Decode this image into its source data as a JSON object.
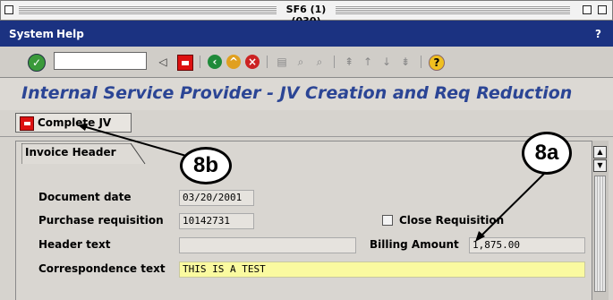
{
  "window": {
    "title": "SF6 (1) (030)"
  },
  "menu": {
    "items": [
      "System",
      "Help"
    ],
    "help_mark": "?"
  },
  "heading": {
    "title": "Internal Service Provider - JV Creation and Req Reduction"
  },
  "app_toolbar": {
    "complete_label": "Complete JV"
  },
  "form": {
    "tab_label": "Invoice Header",
    "document_date_label": "Document date",
    "document_date_value": "03/20/2001",
    "purchase_requisition_label": "Purchase requisition",
    "purchase_requisition_value": "10142731",
    "close_requisition_label": "Close Requisition",
    "header_text_label": "Header text",
    "header_text_value": "",
    "billing_amount_label": "Billing Amount",
    "billing_amount_value": "1,875.00",
    "correspondence_label": "Correspondence text",
    "correspondence_value": "THIS IS A TEST"
  },
  "callouts": {
    "a": "8a",
    "b": "8b"
  },
  "colors": {
    "menubar": "#1b3281",
    "heading_text": "#2b4595",
    "highlight_field": "#fafaa0"
  },
  "icons": [
    "enter-icon",
    "save-icon",
    "back-icon",
    "exit-icon",
    "cancel-icon",
    "print-icon",
    "find-icon",
    "find-next-icon",
    "first-page-icon",
    "previous-page-icon",
    "next-page-icon",
    "last-page-icon",
    "help-icon"
  ]
}
